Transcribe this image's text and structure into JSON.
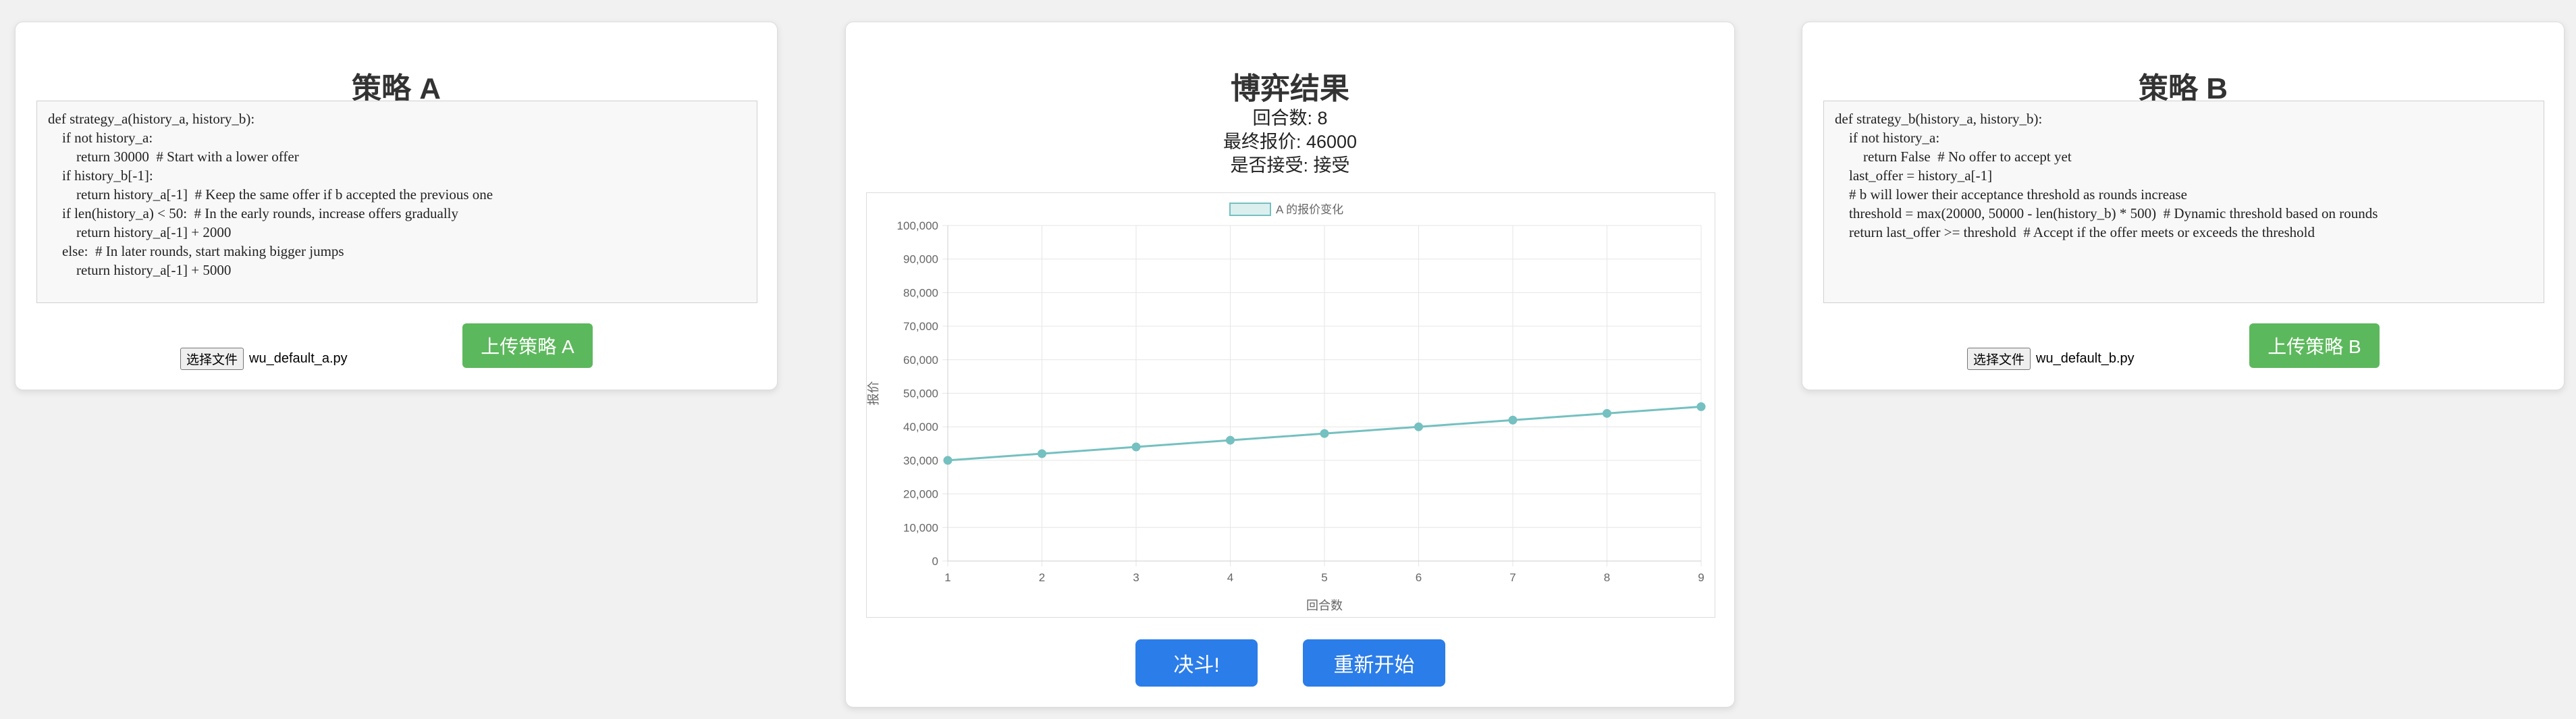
{
  "strategy_a": {
    "title": "策略 A",
    "code": "def strategy_a(history_a, history_b):\n    if not history_a:\n        return 30000  # Start with a lower offer\n    if history_b[-1]:\n        return history_a[-1]  # Keep the same offer if b accepted the previous one\n    if len(history_a) < 50:  # In the early rounds, increase offers gradually\n        return history_a[-1] + 2000\n    else:  # In later rounds, start making bigger jumps\n        return history_a[-1] + 5000",
    "file_button_label": "选择文件",
    "file_name": "wu_default_a.py",
    "upload_label": "上传策略 A"
  },
  "strategy_b": {
    "title": "策略 B",
    "code": "def strategy_b(history_a, history_b):\n    if not history_a:\n        return False  # No offer to accept yet\n    last_offer = history_a[-1]\n    # b will lower their acceptance threshold as rounds increase\n    threshold = max(20000, 50000 - len(history_b) * 500)  # Dynamic threshold based on rounds\n    return last_offer >= threshold  # Accept if the offer meets or exceeds the threshold",
    "file_button_label": "选择文件",
    "file_name": "wu_default_b.py",
    "upload_label": "上传策略 B"
  },
  "result": {
    "title": "博弈结果",
    "rounds_text": "回合数: 8",
    "final_offer_text": "最终报价: 46000",
    "accepted_text": "是否接受: 接受",
    "fight_label": "决斗!",
    "restart_label": "重新开始"
  },
  "chart_data": {
    "type": "line",
    "x": [
      1,
      2,
      3,
      4,
      5,
      6,
      7,
      8,
      9
    ],
    "series": [
      {
        "name": "A 的报价变化",
        "values": [
          30000,
          32000,
          34000,
          36000,
          38000,
          40000,
          42000,
          44000,
          46000
        ],
        "color": "#75c0c0"
      }
    ],
    "xlabel": "回合数",
    "ylabel": "报价",
    "ylim": [
      0,
      100000
    ],
    "yticks": [
      0,
      10000,
      20000,
      30000,
      40000,
      50000,
      60000,
      70000,
      80000,
      90000,
      100000
    ],
    "ytick_labels": [
      "0",
      "10,000",
      "20,000",
      "30,000",
      "40,000",
      "50,000",
      "60,000",
      "70,000",
      "80,000",
      "90,000",
      "100,000"
    ],
    "xlim": [
      1,
      9
    ],
    "grid": true,
    "legend": "top"
  },
  "colors": {
    "upload_button": "#5cb85c",
    "action_button": "#2b7de9",
    "line": "#75c0c0"
  }
}
